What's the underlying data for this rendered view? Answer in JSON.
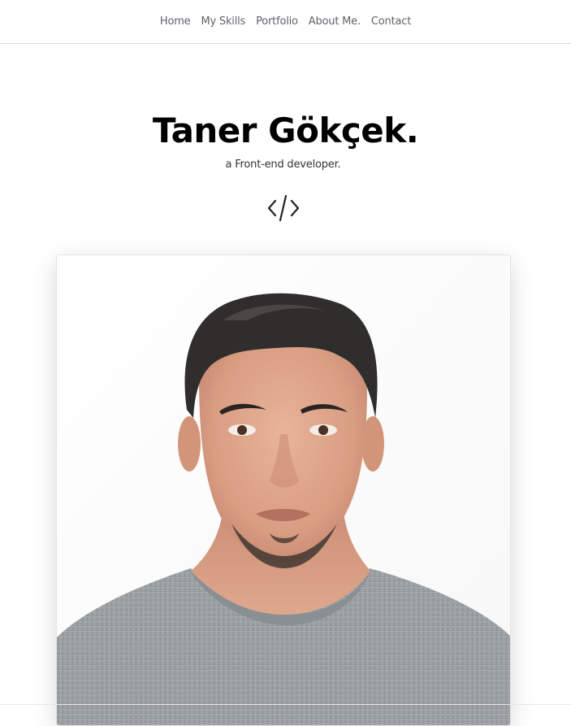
{
  "nav": {
    "items": [
      {
        "label": "Home"
      },
      {
        "label": "My Skills"
      },
      {
        "label": "Portfolio"
      },
      {
        "label": "About Me."
      },
      {
        "label": "Contact"
      }
    ]
  },
  "hero": {
    "title": "Taner Gökçek.",
    "subtitle": "a Front-end developer.",
    "icon": "code-icon"
  },
  "profile": {
    "photo_icon": "portrait-photo"
  },
  "colors": {
    "nav_text": "#5f6368",
    "title": "#000000",
    "border": "#dee2e6",
    "shirt": "#9ea3a8"
  }
}
